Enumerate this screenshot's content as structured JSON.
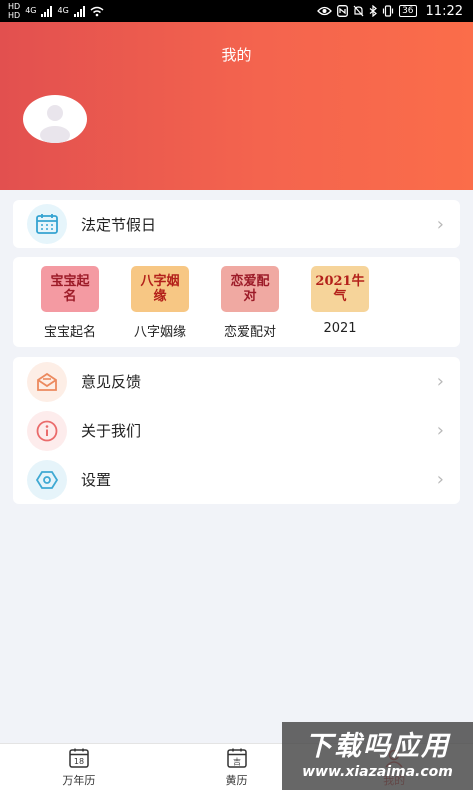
{
  "status_bar": {
    "left_tags": [
      "HD",
      "HD"
    ],
    "net": [
      "4G",
      "4G"
    ],
    "battery": "36",
    "time": "11:22"
  },
  "header": {
    "title": "我的",
    "bg_start": "#e2504f",
    "bg_end": "#fb6d4a"
  },
  "holiday": {
    "label": "法定节假日",
    "icon": "calendar-icon"
  },
  "apps": [
    {
      "label": "宝宝起名",
      "tile_text": "宝宝起名",
      "tile_bg": "#f49aa2",
      "tile_color": "#9c1b28"
    },
    {
      "label": "八字姻缘",
      "tile_text": "八字姻缘",
      "tile_bg": "#f7c784",
      "tile_color": "#b3201a"
    },
    {
      "label": "恋爱配对",
      "tile_text": "恋爱配对",
      "tile_bg": "#f0a9a2",
      "tile_color": "#9c1b28"
    },
    {
      "label": "2021",
      "tile_text": "2021牛气",
      "tile_bg": "#f6d49a",
      "tile_color": "#b3201a"
    }
  ],
  "menu": [
    {
      "label": "意见反馈",
      "icon": "feedback-icon"
    },
    {
      "label": "关于我们",
      "icon": "info-icon"
    },
    {
      "label": "设置",
      "icon": "settings-icon"
    }
  ],
  "bottom_nav": [
    {
      "label": "万年历",
      "icon_text": "18",
      "active": false
    },
    {
      "label": "黄历",
      "icon_text": "吉",
      "active": false
    },
    {
      "label": "我的",
      "icon_text": "",
      "active": true
    }
  ],
  "watermark": {
    "title": "下载吗应用",
    "url": "www.xiazaima.com"
  },
  "accent": "#e2504f"
}
